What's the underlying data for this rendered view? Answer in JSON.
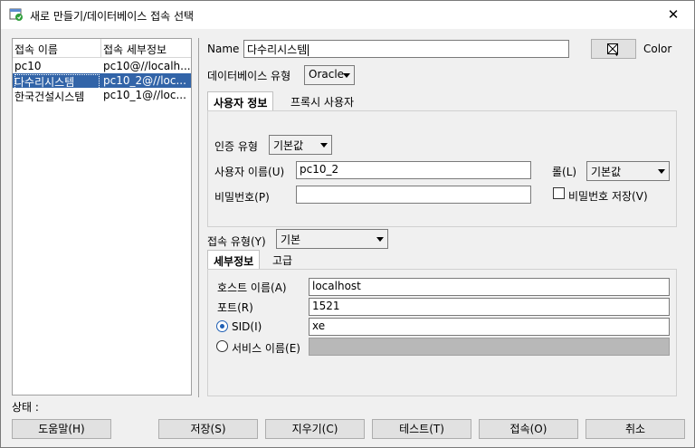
{
  "window": {
    "title": "새로 만들기/데이터베이스 접속 선택",
    "close_glyph": "✕"
  },
  "connections": {
    "headers": [
      "접속 이름",
      "접속 세부정보"
    ],
    "rows": [
      {
        "name": "pc10",
        "detail": "pc10@//localh..."
      },
      {
        "name": "다수리시스템",
        "detail": "pc10_2@//loc..."
      },
      {
        "name": "한국건설시스템",
        "detail": "pc10_1@//loc..."
      }
    ],
    "selected_index": 1
  },
  "form": {
    "name_label": "Name",
    "name_value": "다수리시스템",
    "color_label": "Color",
    "color_icon": "color-picker-icon",
    "db_type_label": "데이터베이스 유형",
    "db_type_value": "Oracle"
  },
  "user_tabs": [
    "사용자 정보",
    "프록시 사용자"
  ],
  "user_info": {
    "auth_type_label": "인증 유형",
    "auth_type_value": "기본값",
    "username_label": "사용자 이름(U)",
    "username_value": "pc10_2",
    "role_label": "롤(L)",
    "role_value": "기본값",
    "password_label": "비밀번호(P)",
    "password_value": "",
    "save_password_label": "비밀번호 저장(V)",
    "save_password_checked": false
  },
  "conn_type": {
    "label": "접속 유형(Y)",
    "value": "기본"
  },
  "detail_tabs": [
    "세부정보",
    "고급"
  ],
  "details": {
    "host_label": "호스트 이름(A)",
    "host_value": "localhost",
    "port_label": "포트(R)",
    "port_value": "1521",
    "sid_label": "SID(I)",
    "sid_value": "xe",
    "sid_selected": true,
    "service_label": "서비스 이름(E)",
    "service_value": ""
  },
  "status_label": "상태 :",
  "buttons": {
    "help": "도움말(H)",
    "save": "저장(S)",
    "clear": "지우기(C)",
    "test": "테스트(T)",
    "connect": "접속(O)",
    "cancel": "취소"
  },
  "colors": {
    "selection": "#3264a8",
    "radio_accent": "#1f5fb4"
  }
}
